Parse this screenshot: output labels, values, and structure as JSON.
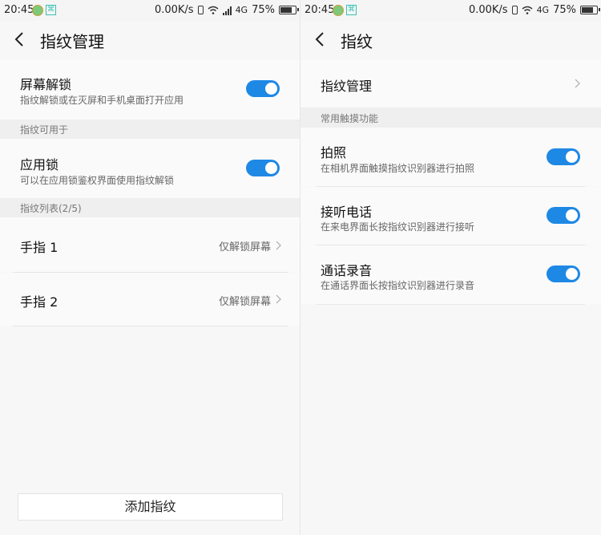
{
  "status_bar": {
    "time": "20:45",
    "speed": "0.00K/s",
    "network": "4G",
    "battery": "75%"
  },
  "left": {
    "title": "指纹管理",
    "screen_unlock": {
      "title": "屏幕解锁",
      "subtitle": "指纹解锁或在灭屏和手机桌面打开应用",
      "enabled": true
    },
    "section_usable": "指纹可用于",
    "app_lock": {
      "title": "应用锁",
      "subtitle": "可以在应用锁鉴权界面使用指纹解锁",
      "enabled": true
    },
    "section_list": "指纹列表(2/5)",
    "fingers": [
      {
        "name": "手指 1",
        "value": "仅解锁屏幕"
      },
      {
        "name": "手指 2",
        "value": "仅解锁屏幕"
      }
    ],
    "add_button": "添加指纹"
  },
  "right": {
    "title": "指纹",
    "manage": "指纹管理",
    "section_touch": "常用触摸功能",
    "features": [
      {
        "title": "拍照",
        "subtitle": "在相机界面触摸指纹识别器进行拍照",
        "enabled": true
      },
      {
        "title": "接听电话",
        "subtitle": "在来电界面长按指纹识别器进行接听",
        "enabled": true
      },
      {
        "title": "通话录音",
        "subtitle": "在通话界面长按指纹识别器进行录音",
        "enabled": true
      }
    ]
  },
  "colors": {
    "accent": "#1e88e5",
    "background": "#f7f7f7",
    "section": "#efefef"
  }
}
